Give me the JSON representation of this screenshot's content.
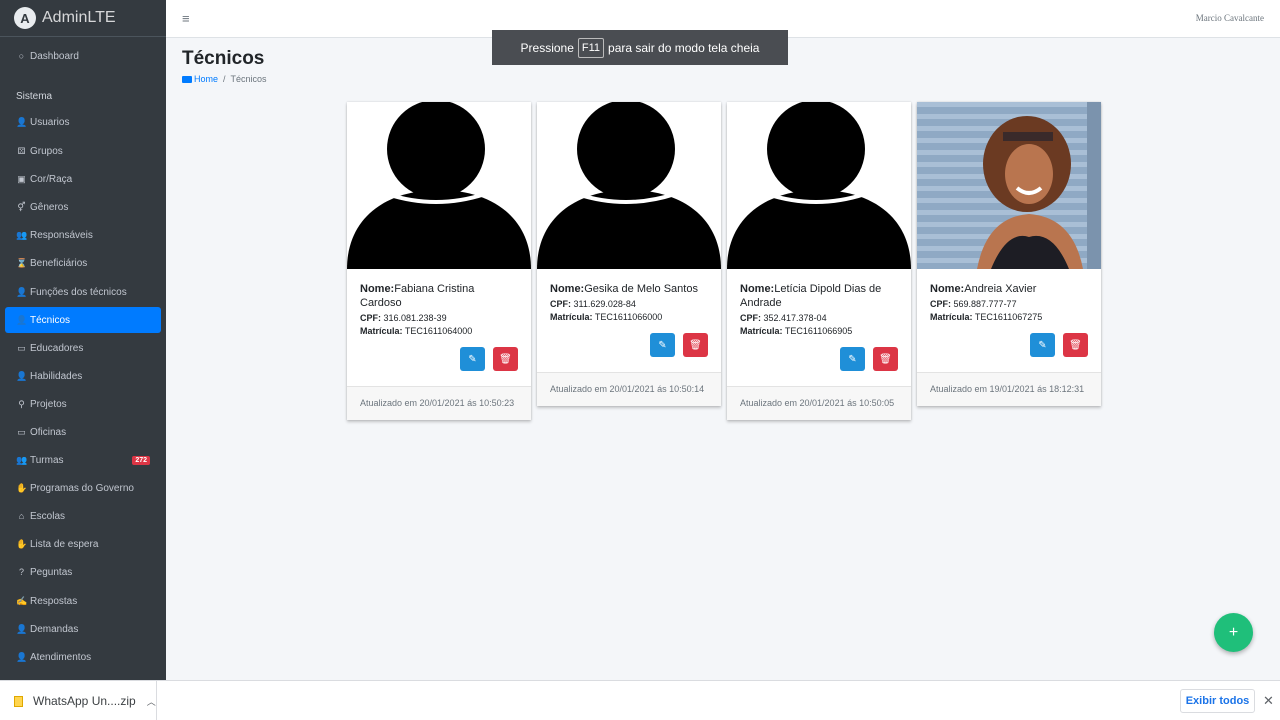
{
  "brand": {
    "logo": "A",
    "name": "AdminLTE"
  },
  "sidebar": {
    "dashboard": {
      "icon": "○",
      "label": "Dashboard"
    },
    "section_header": "Sistema",
    "items": [
      {
        "icon": "👤",
        "label": "Usuarios"
      },
      {
        "icon": "⚄",
        "label": "Grupos"
      },
      {
        "icon": "▣",
        "label": "Cor/Raça"
      },
      {
        "icon": "⚥",
        "label": "Gêneros"
      },
      {
        "icon": "👥",
        "label": "Responsáveis"
      },
      {
        "icon": "⌛",
        "label": "Beneficiários"
      },
      {
        "icon": "👤",
        "label": "Funções dos técnicos"
      },
      {
        "icon": "👤",
        "label": "Técnicos"
      },
      {
        "icon": "▭",
        "label": "Educadores"
      },
      {
        "icon": "👤",
        "label": "Habilidades"
      },
      {
        "icon": "⚲",
        "label": "Projetos"
      },
      {
        "icon": "▭",
        "label": "Oficinas"
      },
      {
        "icon": "👥",
        "label": "Turmas",
        "badge": "272"
      },
      {
        "icon": "✋",
        "label": "Programas do Governo"
      },
      {
        "icon": "⌂",
        "label": "Escolas"
      },
      {
        "icon": "✋",
        "label": "Lista de espera"
      },
      {
        "icon": "?",
        "label": "Peguntas"
      },
      {
        "icon": "✍",
        "label": "Respostas"
      },
      {
        "icon": "👤",
        "label": "Demandas"
      },
      {
        "icon": "👤",
        "label": "Atendimentos"
      }
    ]
  },
  "navbar": {
    "menu_icon": "≡",
    "user": "Marcio Cavalcante"
  },
  "toast": {
    "before": "Pressione",
    "key": "F11",
    "after": "para sair do modo tela cheia"
  },
  "page": {
    "title": "Técnicos",
    "breadcrumb_home": "Home",
    "breadcrumb_sep": "/",
    "breadcrumb_current": "Técnicos"
  },
  "labels": {
    "nome": "Nome:",
    "cpf": "CPF:",
    "matricula": "Matrícula:"
  },
  "cards": [
    {
      "nome": "Fabiana Cristina Cardoso",
      "cpf": "316.081.238-39",
      "matricula": "TEC1611064000",
      "updated": "Atualizado em 20/01/2021 ás 10:50:23",
      "photo": "placeholder"
    },
    {
      "nome": "Gesika de Melo Santos",
      "cpf": "311.629.028-84",
      "matricula": "TEC1611066000",
      "updated": "Atualizado em 20/01/2021 ás 10:50:14",
      "photo": "placeholder"
    },
    {
      "nome": "Letícia Dipold Dias de Andrade",
      "cpf": "352.417.378-04",
      "matricula": "TEC1611066905",
      "updated": "Atualizado em 20/01/2021 ás 10:50:05",
      "photo": "placeholder"
    },
    {
      "nome": "Andreia Xavier",
      "cpf": "569.887.777-77",
      "matricula": "TEC1611067275",
      "updated": "Atualizado em 19/01/2021 ás 18:12:31",
      "photo": "portrait"
    }
  ],
  "fab": {
    "icon": "+"
  },
  "downloads": {
    "file": "WhatsApp Un....zip",
    "show_all": "Exibir todos",
    "close": "✕"
  },
  "colors": {
    "sidebar": "#343a40",
    "active": "#007bff",
    "edit": "#1f8fd8",
    "delete": "#dc3545",
    "fab": "#1fbf7a"
  }
}
